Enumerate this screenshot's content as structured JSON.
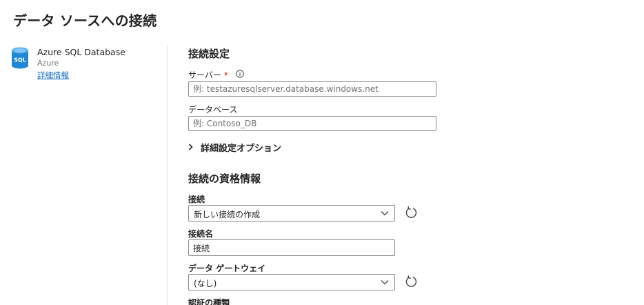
{
  "page": {
    "title": "データ ソースへの接続"
  },
  "connector": {
    "name": "Azure SQL Database",
    "category": "Azure",
    "details_link": "詳細情報",
    "icon": "sql-database-icon",
    "icon_text": "SQL",
    "icon_color": "#1e88d6"
  },
  "connection_settings": {
    "title": "接続設定",
    "server": {
      "label": "サーバー",
      "required_mark": "*",
      "info_icon": "info-icon",
      "value": "",
      "placeholder": "例: testazuresqlserver.database.windows.net"
    },
    "database": {
      "label": "データベース",
      "value": "",
      "placeholder": "例: Contoso_DB"
    },
    "advanced_options": {
      "label": "詳細設定オプション",
      "expanded": false
    }
  },
  "credentials": {
    "title": "接続の資格情報",
    "connection": {
      "label": "接続",
      "selected": "新しい接続の作成",
      "refresh_icon": "refresh-icon"
    },
    "connection_name": {
      "label": "接続名",
      "value": "接続"
    },
    "data_gateway": {
      "label": "データ ゲートウェイ",
      "selected": "(なし)",
      "refresh_icon": "refresh-icon"
    },
    "auth_type": {
      "label": "認証の種類"
    }
  },
  "colors": {
    "link": "#0f6cbd",
    "required": "#c50f1f",
    "border": "#8a8a8a",
    "divider": "#e1e1e1"
  }
}
